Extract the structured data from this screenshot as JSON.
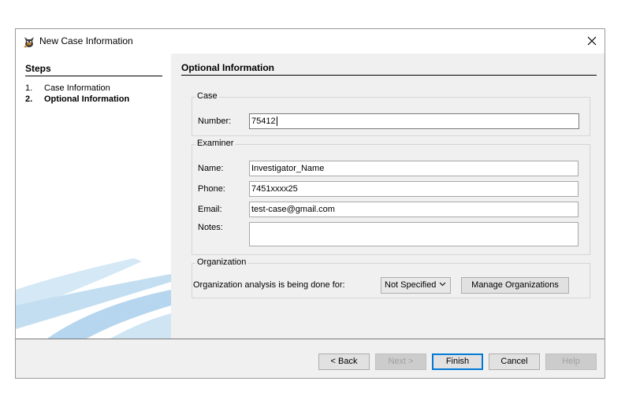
{
  "window": {
    "title": "New Case Information"
  },
  "steps": {
    "title": "Steps",
    "items": [
      {
        "num": "1.",
        "label": "Case Information"
      },
      {
        "num": "2.",
        "label": "Optional Information"
      }
    ]
  },
  "section_title": "Optional Information",
  "case": {
    "group_label": "Case",
    "number_label": "Number:",
    "number_value": "75412"
  },
  "examiner": {
    "group_label": "Examiner",
    "name_label": "Name:",
    "name_value": "Investigator_Name",
    "phone_label": "Phone:",
    "phone_value": "7451xxxx25",
    "email_label": "Email:",
    "email_value": "test-case@gmail.com",
    "notes_label": "Notes:",
    "notes_value": ""
  },
  "organization": {
    "group_label": "Organization",
    "prompt": "Organization analysis is being done for:",
    "selected": "Not Specified",
    "manage_label": "Manage Organizations"
  },
  "footer": {
    "back": "< Back",
    "next": "Next >",
    "finish": "Finish",
    "cancel": "Cancel",
    "help": "Help"
  },
  "icons": {
    "app": "autopsy-dog-icon",
    "close": "close-icon",
    "dropdown": "chevron-down-icon"
  },
  "colors": {
    "default_button_border": "#0078d7",
    "swoosh": "#bcdcf0"
  }
}
